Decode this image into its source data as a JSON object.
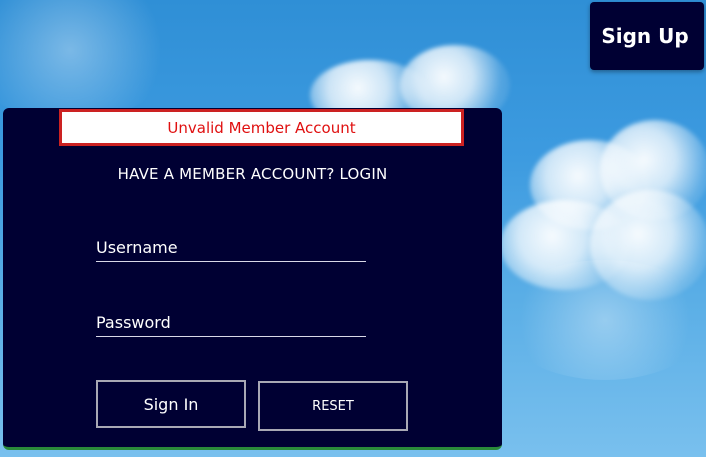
{
  "header": {
    "signup_label": "Sign Up"
  },
  "login": {
    "error_message": "Unvalid Member Account",
    "heading": "HAVE A MEMBER ACCOUNT? LOGIN",
    "username_placeholder": "Username",
    "password_placeholder": "Password",
    "signin_label": "Sign In",
    "reset_label": "RESET"
  },
  "colors": {
    "panel": "#000033",
    "error_text": "#e01010",
    "error_border": "#cc2222",
    "sky": "#3d9be0"
  }
}
